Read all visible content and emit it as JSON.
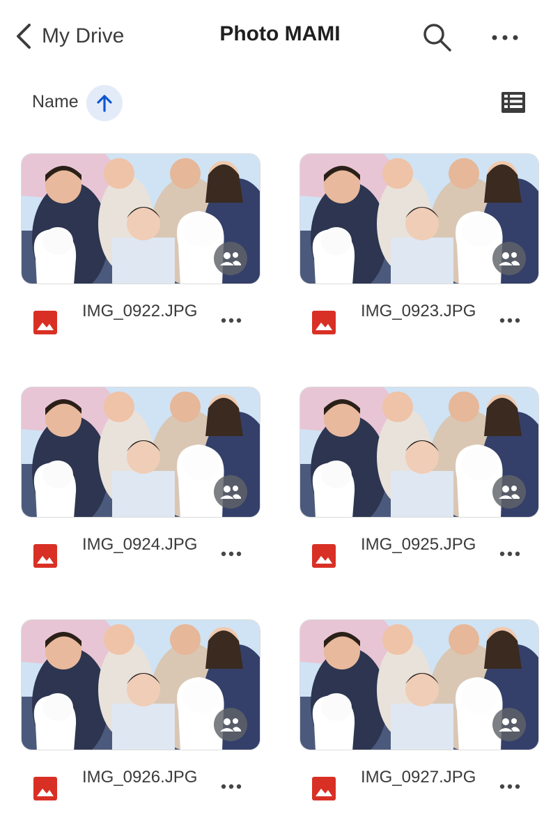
{
  "header": {
    "back_label": "My Drive",
    "title": "Photo MAMI",
    "icons": {
      "back": "chevron-left-icon",
      "search": "search-icon",
      "more": "more-horiz-icon"
    }
  },
  "sort": {
    "label": "Name",
    "direction": "ascending",
    "icons": {
      "direction": "arrow-up-icon",
      "view": "list-view-icon"
    }
  },
  "files": [
    {
      "name": "IMG_0922.JPG",
      "shared": true
    },
    {
      "name": "IMG_0923.JPG",
      "shared": true
    },
    {
      "name": "IMG_0924.JPG",
      "shared": true
    },
    {
      "name": "IMG_0925.JPG",
      "shared": true
    },
    {
      "name": "IMG_0926.JPG",
      "shared": true
    },
    {
      "name": "IMG_0927.JPG",
      "shared": true
    }
  ],
  "colors": {
    "image_file_icon": "#d93025",
    "accent": "#0b57d0",
    "sort_chip_bg": "#e3ebf9"
  }
}
